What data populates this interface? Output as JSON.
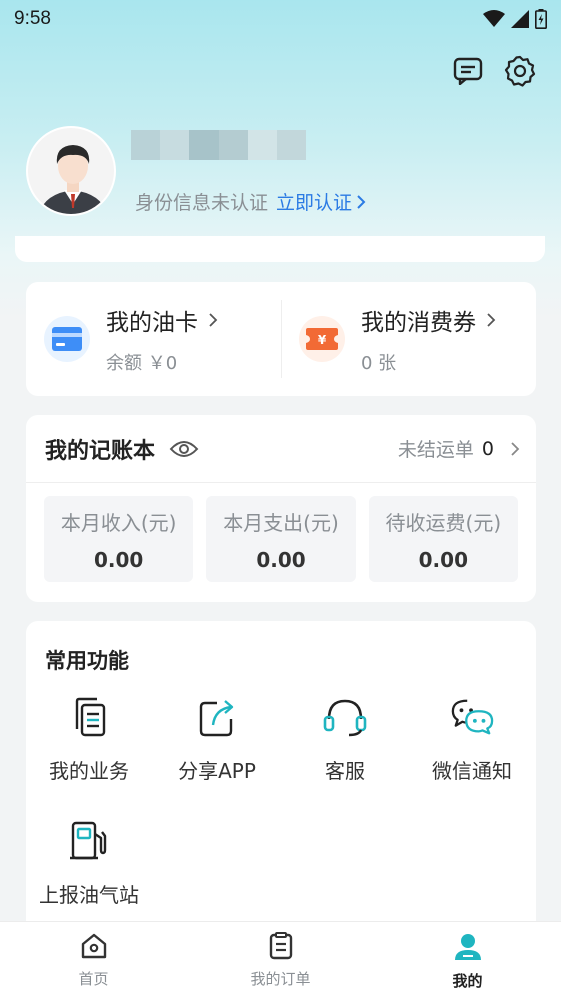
{
  "status_bar": {
    "time": "9:58"
  },
  "header": {
    "message_icon": "message-icon",
    "settings_icon": "gear-icon"
  },
  "profile": {
    "verify_text": "身份信息未认证",
    "verify_link": "立即认证"
  },
  "wallet": {
    "oil_card": {
      "title": "我的油卡",
      "subtitle": "余额 ￥0"
    },
    "coupon": {
      "title": "我的消费券",
      "subtitle": "0 张"
    }
  },
  "ledger": {
    "title": "我的记账本",
    "unsettled_label": "未结运单",
    "unsettled_count": "0",
    "stats": [
      {
        "label": "本月收入(元)",
        "value": "0.00"
      },
      {
        "label": "本月支出(元)",
        "value": "0.00"
      },
      {
        "label": "待收运费(元)",
        "value": "0.00"
      }
    ]
  },
  "functions": {
    "title": "常用功能",
    "items": [
      {
        "label": "我的业务",
        "icon": "documents-icon"
      },
      {
        "label": "分享APP",
        "icon": "share-icon"
      },
      {
        "label": "客服",
        "icon": "headset-icon"
      },
      {
        "label": "微信通知",
        "icon": "wechat-icon"
      },
      {
        "label": "上报油气站",
        "icon": "gas-station-icon"
      }
    ]
  },
  "tabbar": {
    "items": [
      {
        "label": "首页",
        "icon": "home-icon"
      },
      {
        "label": "我的订单",
        "icon": "orders-icon"
      },
      {
        "label": "我的",
        "icon": "user-icon"
      }
    ]
  },
  "colors": {
    "accent": "#1fb5c0",
    "link": "#2b7be4",
    "coupon": "#f26a35"
  }
}
